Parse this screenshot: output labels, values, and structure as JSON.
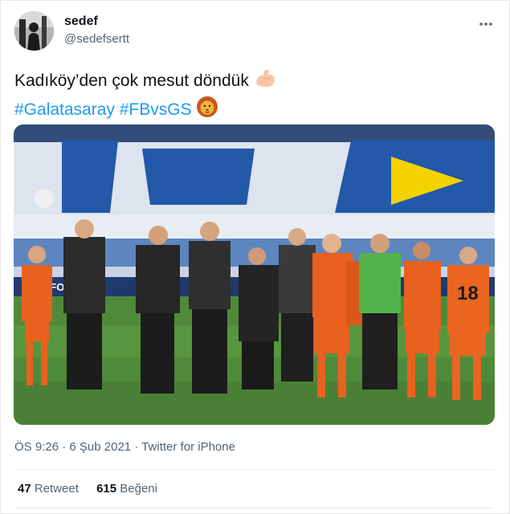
{
  "author": {
    "name": "sedef",
    "handle": "@sedefsertt"
  },
  "tweet": {
    "line1": "Kadıköy’den çok mesut döndük",
    "hashtag1": "#Galatasaray",
    "hashtag2": "#FBvsGS"
  },
  "meta": {
    "time": "ÖS 9:26",
    "separator": "·",
    "date": "6 Şub 2021",
    "source": "Twitter for iPhone"
  },
  "stats": {
    "retweets": "47",
    "retweets_label": "Retweet",
    "likes": "615",
    "likes_label": "Beğeni"
  },
  "photo": {
    "banner_text": "ELEFONI",
    "jersey_number": "18"
  },
  "icons": {
    "more": "more-options-icon",
    "flex": "flexed-biceps-icon",
    "lion": "lion-face-icon"
  },
  "colors": {
    "link": "#1d9bf0",
    "secondary": "#536471",
    "kit_orange": "#e8611f"
  }
}
